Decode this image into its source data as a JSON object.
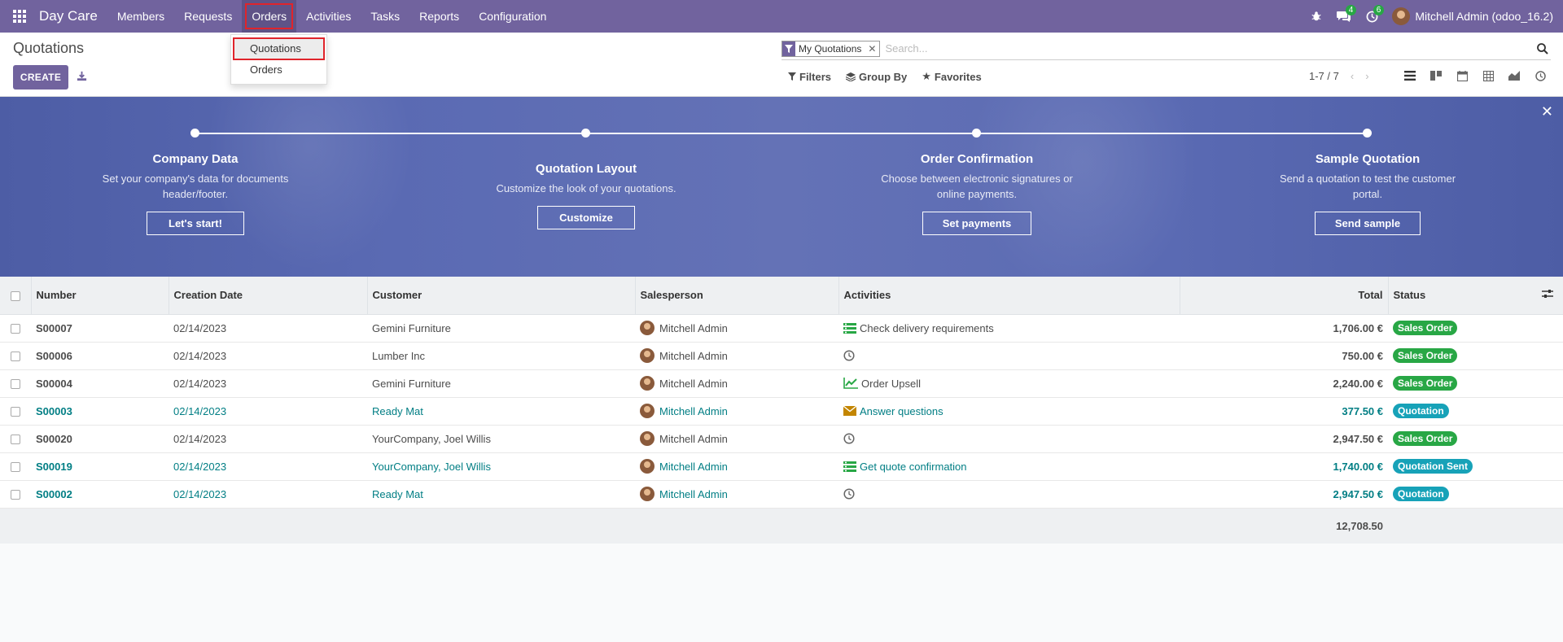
{
  "app": {
    "brand": "Day Care"
  },
  "menu": [
    {
      "label": "Members"
    },
    {
      "label": "Requests"
    },
    {
      "label": "Orders"
    },
    {
      "label": "Activities"
    },
    {
      "label": "Tasks"
    },
    {
      "label": "Reports"
    },
    {
      "label": "Configuration"
    }
  ],
  "systray": {
    "messages_count": "4",
    "activities_count": "6",
    "user_name": "Mitchell Admin (odoo_16.2)"
  },
  "dropdown": {
    "items": [
      {
        "label": "Quotations"
      },
      {
        "label": "Orders"
      }
    ]
  },
  "control": {
    "title": "Quotations",
    "create_label": "CREATE",
    "facet_label": "My Quotations",
    "search_placeholder": "Search...",
    "filters_label": "Filters",
    "groupby_label": "Group By",
    "favorites_label": "Favorites",
    "pager": "1-7 / 7"
  },
  "banner": {
    "steps": [
      {
        "title": "Company Data",
        "desc": "Set your company's data for documents header/footer.",
        "button": "Let's start!"
      },
      {
        "title": "Quotation Layout",
        "desc": "Customize the look of your quotations.",
        "button": "Customize"
      },
      {
        "title": "Order Confirmation",
        "desc": "Choose between electronic signatures or online payments.",
        "button": "Set payments"
      },
      {
        "title": "Sample Quotation",
        "desc": "Send a quotation to test the customer portal.",
        "button": "Send sample"
      }
    ]
  },
  "table": {
    "headers": {
      "number": "Number",
      "date": "Creation Date",
      "customer": "Customer",
      "salesperson": "Salesperson",
      "activities": "Activities",
      "total": "Total",
      "status": "Status"
    },
    "rows": [
      {
        "number": "S00007",
        "date": "02/14/2023",
        "customer": "Gemini Furniture",
        "salesperson": "Mitchell Admin",
        "activity_icon": "todo-list-icon",
        "activity": "Check delivery requirements",
        "total": "1,706.00 €",
        "status": "Sales Order",
        "status_color": "#28a745"
      },
      {
        "number": "S00006",
        "date": "02/14/2023",
        "customer": "Lumber Inc",
        "salesperson": "Mitchell Admin",
        "activity_icon": "clock-icon",
        "activity": "",
        "total": "750.00 €",
        "status": "Sales Order",
        "status_color": "#28a745"
      },
      {
        "number": "S00004",
        "date": "02/14/2023",
        "customer": "Gemini Furniture",
        "salesperson": "Mitchell Admin",
        "activity_icon": "chart-line-icon",
        "activity": "Order Upsell",
        "total": "2,240.00 €",
        "status": "Sales Order",
        "status_color": "#28a745"
      },
      {
        "number": "S00003",
        "date": "02/14/2023",
        "customer": "Ready Mat",
        "salesperson": "Mitchell Admin",
        "activity_icon": "envelope-icon",
        "activity": "Answer questions",
        "total": "377.50 €",
        "status": "Quotation",
        "status_color": "#17a2b8"
      },
      {
        "number": "S00020",
        "date": "02/14/2023",
        "customer": "YourCompany, Joel Willis",
        "salesperson": "Mitchell Admin",
        "activity_icon": "clock-icon",
        "activity": "",
        "total": "2,947.50 €",
        "status": "Sales Order",
        "status_color": "#28a745"
      },
      {
        "number": "S00019",
        "date": "02/14/2023",
        "customer": "YourCompany, Joel Willis",
        "salesperson": "Mitchell Admin",
        "activity_icon": "todo-list-icon",
        "activity": "Get quote confirmation",
        "total": "1,740.00 €",
        "status": "Quotation Sent",
        "status_color": "#17a2b8"
      },
      {
        "number": "S00002",
        "date": "02/14/2023",
        "customer": "Ready Mat",
        "salesperson": "Mitchell Admin",
        "activity_icon": "clock-icon",
        "activity": "",
        "total": "2,947.50 €",
        "status": "Quotation",
        "status_color": "#17a2b8"
      }
    ],
    "footer_total": "12,708.50"
  }
}
